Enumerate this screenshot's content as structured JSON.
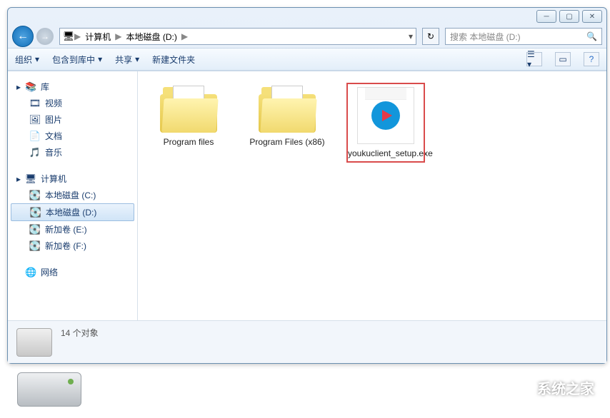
{
  "breadcrumb": {
    "root_icon": "computer",
    "items": [
      "计算机",
      "本地磁盘 (D:)"
    ]
  },
  "search": {
    "placeholder": "搜索 本地磁盘 (D:)"
  },
  "toolbar": {
    "organize": "组织",
    "include": "包含到库中",
    "share": "共享",
    "newfolder": "新建文件夹"
  },
  "sidebar": {
    "libraries": {
      "label": "库",
      "items": [
        {
          "icon": "🎞",
          "label": "视频"
        },
        {
          "icon": "🖼",
          "label": "图片"
        },
        {
          "icon": "📄",
          "label": "文档"
        },
        {
          "icon": "🎵",
          "label": "音乐"
        }
      ]
    },
    "computer": {
      "label": "计算机",
      "items": [
        {
          "icon": "💽",
          "label": "本地磁盘 (C:)",
          "selected": false
        },
        {
          "icon": "💽",
          "label": "本地磁盘 (D:)",
          "selected": true
        },
        {
          "icon": "💽",
          "label": "新加卷 (E:)",
          "selected": false
        },
        {
          "icon": "💽",
          "label": "新加卷 (F:)",
          "selected": false
        }
      ]
    },
    "network": {
      "label": "网络",
      "icon": "🌐"
    }
  },
  "files": [
    {
      "type": "folder",
      "name": "Program files",
      "highlighted": false
    },
    {
      "type": "folder",
      "name": "Program Files (x86)",
      "highlighted": false
    },
    {
      "type": "exe",
      "name": "youkuclient_setup.exe",
      "highlighted": true
    }
  ],
  "status": {
    "count_text": "14 个对象"
  },
  "watermark": "系统之家"
}
